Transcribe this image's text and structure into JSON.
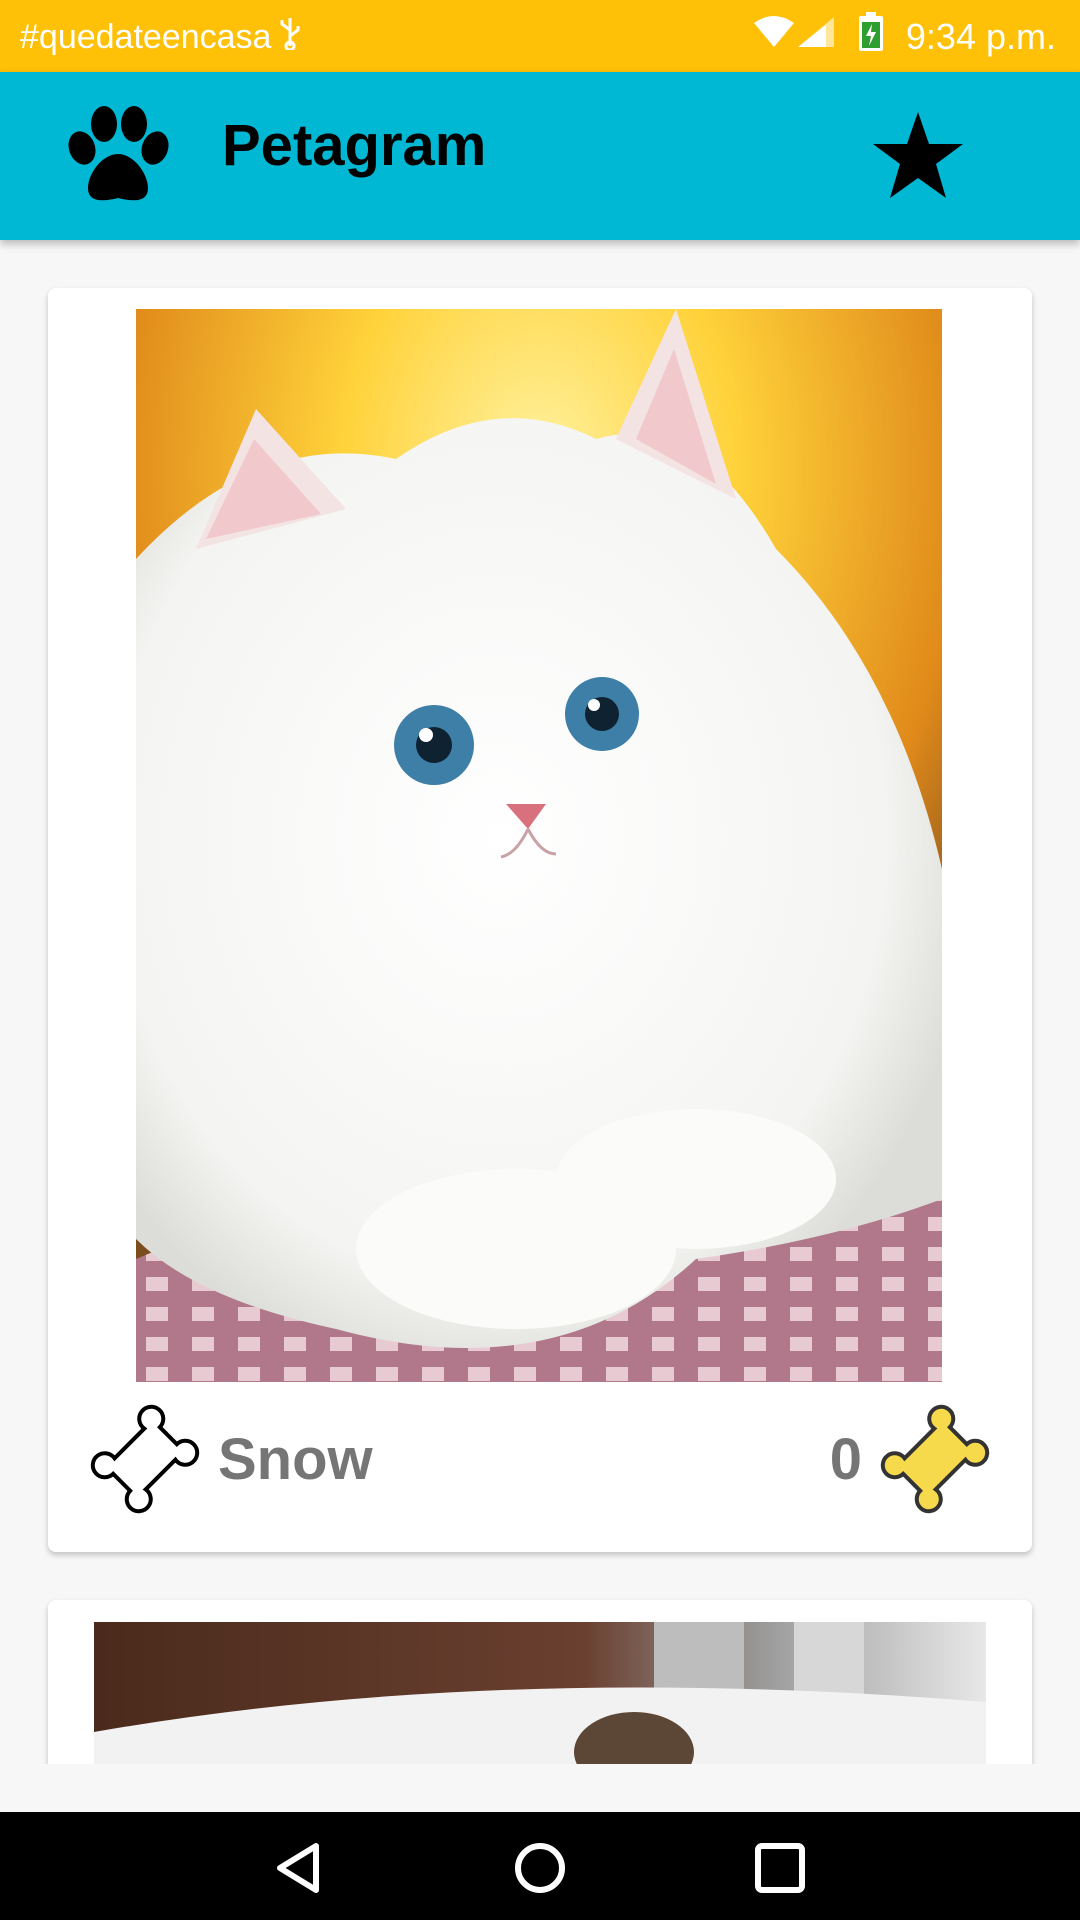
{
  "status_bar": {
    "notification_text": "#quedateencasa",
    "time": "9:34 p.m.",
    "icons": [
      "usb-icon",
      "wifi-icon",
      "signal-icon",
      "battery-charging-icon"
    ]
  },
  "app_bar": {
    "title": "Petagram",
    "logo_icon": "paw-icon",
    "action_icon": "star-icon"
  },
  "feed": {
    "pets": [
      {
        "name": "Snow",
        "likes": "0",
        "photo": "white fluffy cat",
        "like_icon": "bone-outline-icon",
        "rating_icon": "bone-filled-icon"
      },
      {
        "photo": "pet photo (partially visible)"
      }
    ]
  },
  "colors": {
    "status_bar": "#ffc107",
    "app_bar": "#00b8d4",
    "bone_fill": "#f7d94c",
    "text_gray": "#757575"
  },
  "nav_bar": {
    "buttons": [
      "back-icon",
      "home-icon",
      "recents-icon"
    ]
  }
}
